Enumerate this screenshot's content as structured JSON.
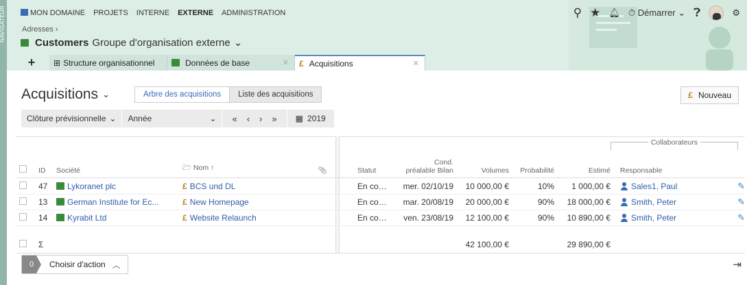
{
  "navigator": {
    "label": "NAVIGATEUR"
  },
  "topnav": [
    {
      "label": "MON DOMAINE",
      "active": false
    },
    {
      "label": "PROJETS",
      "active": false
    },
    {
      "label": "INTERNE",
      "active": false
    },
    {
      "label": "EXTERNE",
      "active": true
    },
    {
      "label": "ADMINISTRATION",
      "active": false
    }
  ],
  "breadcrumb": "Adresses ›",
  "header": {
    "title": "Customers",
    "subtitle": "Groupe d'organisation externe"
  },
  "topright": {
    "start_label": "Démarrer"
  },
  "tabs": [
    {
      "label": "Structure organisationnel"
    },
    {
      "label": "Données de base"
    },
    {
      "label": "Acquisitions"
    }
  ],
  "main": {
    "title": "Acquisitions",
    "view_tree": "Arbre des acquisitions",
    "view_list": "Liste des acquisitions",
    "new_button": "Nouveau"
  },
  "filters": {
    "closing": "Clôture prévisionnelle",
    "period": "Année",
    "year": "2019"
  },
  "table": {
    "group_header": "Collaborateurs",
    "headers": {
      "id": "ID",
      "company": "Société",
      "name": "Nom ↑",
      "status": "Statut",
      "cond1": "Cond.",
      "cond2": "préalable Bilan",
      "volumes": "Volumes",
      "probability": "Probabilité",
      "estimated": "Estimé",
      "responsible": "Responsable"
    },
    "rows": [
      {
        "id": "47",
        "company": "Lykoranet plc",
        "name": "BCS und DL",
        "status": "En cours",
        "date": "mer. 02/10/19",
        "volume": "10 000,00 €",
        "prob": "10%",
        "est": "1 000,00 €",
        "resp": "Sales1, Paul"
      },
      {
        "id": "13",
        "company": "German Institute for Ec...",
        "name": "New Homepage",
        "status": "En cours",
        "date": "mar. 20/08/19",
        "volume": "20 000,00 €",
        "prob": "90%",
        "est": "18 000,00 €",
        "resp": "Smith, Peter"
      },
      {
        "id": "14",
        "company": "Kyrabit Ltd",
        "name": "Website Relaunch",
        "status": "En cours",
        "date": "ven. 23/08/19",
        "volume": "12 100,00 €",
        "prob": "90%",
        "est": "10 890,00 €",
        "resp": "Smith, Peter"
      }
    ],
    "sum": {
      "symbol": "Σ",
      "volume": "42 100,00 €",
      "est": "29 890,00 €"
    }
  },
  "footer": {
    "count": "0",
    "action_label": "Choisir d'action"
  }
}
